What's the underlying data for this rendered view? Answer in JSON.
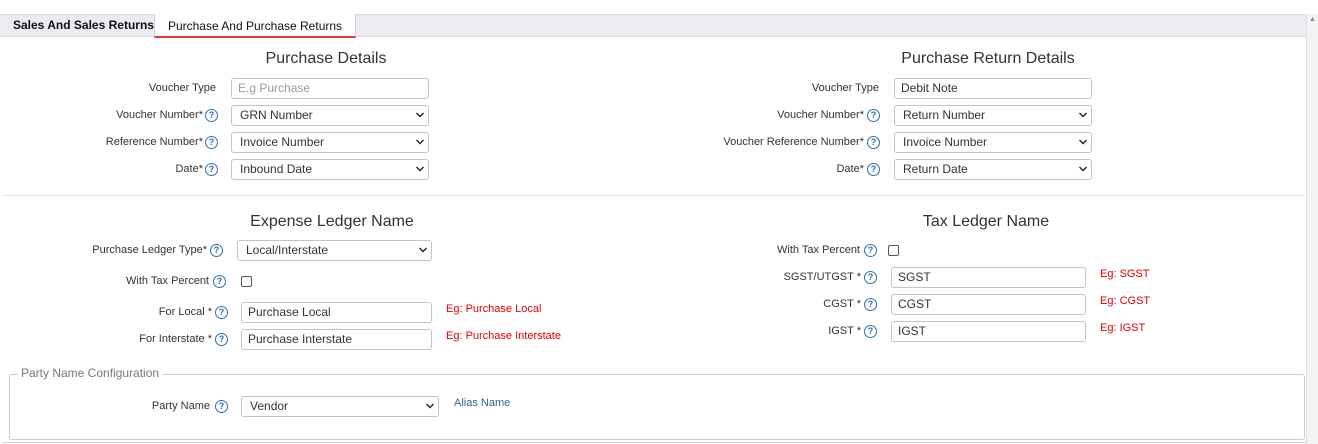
{
  "tabs": [
    {
      "label": "Sales And Sales Returns",
      "active": false
    },
    {
      "label": "Purchase And Purchase Returns",
      "active": true
    }
  ],
  "colors": {
    "accent": "#e03a3a",
    "hint": "#e00000",
    "help_icon": "#2a6fb5",
    "link": "#2b6a9a"
  },
  "purchase_details": {
    "title": "Purchase Details",
    "voucher_type": {
      "label": "Voucher Type",
      "placeholder": "E.g Purchase",
      "value": ""
    },
    "voucher_number": {
      "label": "Voucher Number*",
      "value": "GRN Number"
    },
    "reference_number": {
      "label": "Reference Number*",
      "value": "Invoice Number"
    },
    "date": {
      "label": "Date*",
      "value": "Inbound Date"
    }
  },
  "purchase_return_details": {
    "title": "Purchase Return Details",
    "voucher_type": {
      "label": "Voucher Type",
      "value": "Debit Note"
    },
    "voucher_number": {
      "label": "Voucher Number*",
      "value": "Return Number"
    },
    "voucher_reference_number": {
      "label": "Voucher Reference Number*",
      "value": "Invoice Number"
    },
    "date": {
      "label": "Date*",
      "value": "Return Date"
    }
  },
  "expense_ledger": {
    "title": "Expense Ledger Name",
    "purchase_ledger_type": {
      "label": "Purchase Ledger Type*",
      "value": "Local/Interstate"
    },
    "with_tax_percent": {
      "label": "With Tax Percent",
      "checked": false
    },
    "for_local": {
      "label": "For Local *",
      "value": "Purchase Local",
      "hint": "Eg: Purchase Local"
    },
    "for_interstate": {
      "label": "For Interstate *",
      "value": "Purchase Interstate",
      "hint": "Eg: Purchase Interstate"
    }
  },
  "tax_ledger": {
    "title": "Tax Ledger Name",
    "with_tax_percent": {
      "label": "With Tax Percent",
      "checked": false
    },
    "sgst": {
      "label": "SGST/UTGST *",
      "value": "SGST",
      "hint": "Eg: SGST"
    },
    "cgst": {
      "label": "CGST *",
      "value": "CGST",
      "hint": "Eg: CGST"
    },
    "igst": {
      "label": "IGST *",
      "value": "IGST",
      "hint": "Eg: IGST"
    }
  },
  "party_name_config": {
    "legend": "Party Name Configuration",
    "party_name": {
      "label": "Party Name",
      "value": "Vendor"
    },
    "alias_link": "Alias Name"
  },
  "icons": {
    "help": "?"
  }
}
